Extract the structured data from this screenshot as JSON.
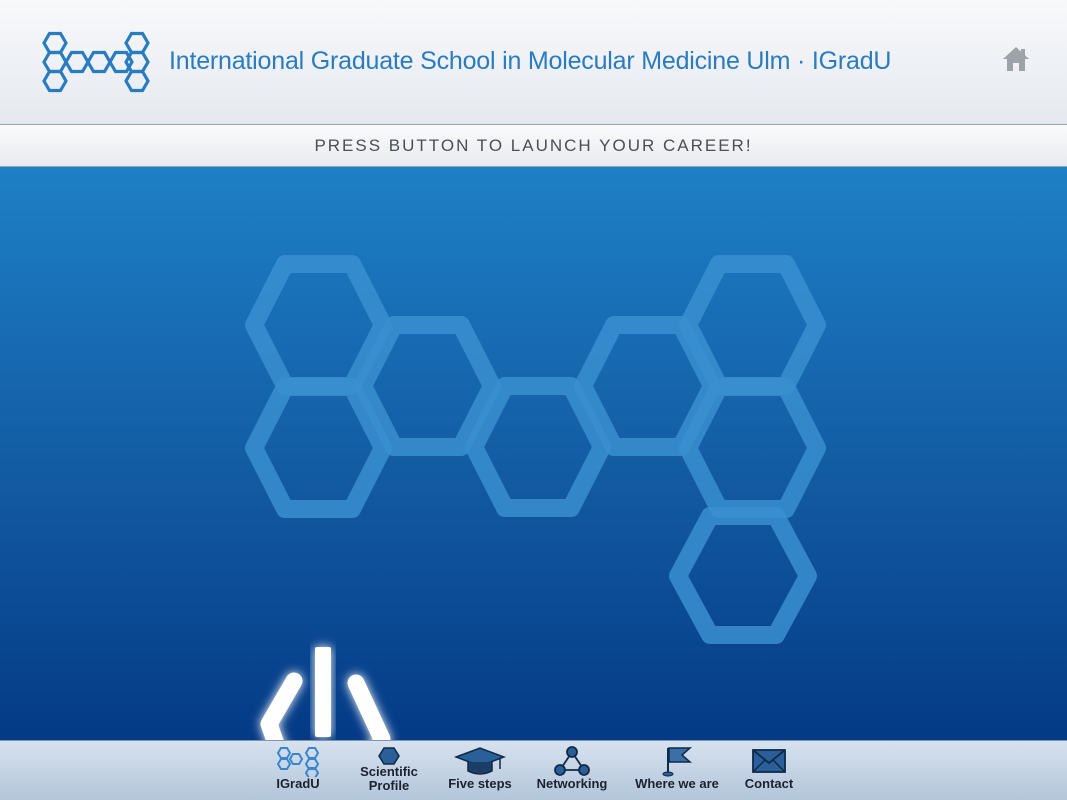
{
  "header": {
    "title": "International Graduate School in Molecular Medicine Ulm · IGradU",
    "logo_icon": "hexagon-molecule-logo-icon",
    "home_icon": "home-icon"
  },
  "banner": {
    "text": "PRESS BUTTON TO LAUNCH YOUR CAREER!"
  },
  "stage": {
    "graphic": "hexagon-molecule-graphic",
    "button_icon": "power-icon"
  },
  "tabbar": {
    "tabs": [
      {
        "id": "igradu",
        "label": "IGradU",
        "icon": "molecule-icon"
      },
      {
        "id": "scientific",
        "label": "Scientific Profile",
        "line1": "Scientific",
        "line2": "Profile",
        "icon": "hexagon-icon"
      },
      {
        "id": "fivesteps",
        "label": "Five steps",
        "icon": "graduation-cap-icon"
      },
      {
        "id": "networking",
        "label": "Networking",
        "icon": "network-icon"
      },
      {
        "id": "where",
        "label": "Where we are",
        "icon": "flag-icon"
      },
      {
        "id": "contact",
        "label": "Contact",
        "icon": "envelope-icon"
      }
    ]
  },
  "colors": {
    "accent": "#2a7cc0",
    "stage_top": "#1e80c6",
    "stage_bottom": "#043a86",
    "hex_stroke": "#3a8fd0"
  }
}
